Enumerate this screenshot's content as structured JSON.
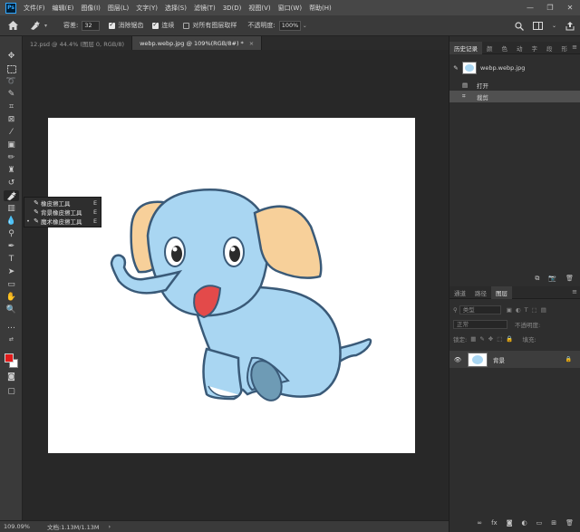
{
  "app": {
    "logo": "Ps",
    "menu": [
      "文件(F)",
      "编辑(E)",
      "图像(I)",
      "图层(L)",
      "文字(Y)",
      "选择(S)",
      "滤镜(T)",
      "3D(D)",
      "视图(V)",
      "窗口(W)",
      "帮助(H)"
    ],
    "window_controls": {
      "minimize": "—",
      "restore": "❐",
      "close": "✕"
    }
  },
  "options": {
    "tolerance_label": "容差:",
    "tolerance_value": "32",
    "antialias_label": "消除锯齿",
    "contiguous_label": "连续",
    "all_layers_label": "对所有图层取样",
    "opacity_label": "不透明度:",
    "opacity_value": "100%"
  },
  "tabs": [
    {
      "label": "12.psd @ 44.4% (图层 0, RGB/8)",
      "active": false
    },
    {
      "label": "webp.webp.jpg @ 109%(RGB/8#) *",
      "active": true,
      "close": "×"
    }
  ],
  "flyout": {
    "items": [
      {
        "label": "橡皮擦工具",
        "key": "E",
        "selected": false
      },
      {
        "label": "背景橡皮擦工具",
        "key": "E",
        "selected": false
      },
      {
        "label": "魔术橡皮擦工具",
        "key": "E",
        "selected": true
      }
    ],
    "dot": "•"
  },
  "status": {
    "zoom": "109.09%",
    "doc": "文档:1.13M/1.13M",
    "arrow": "›"
  },
  "history_panel": {
    "tabs": [
      "历史记录",
      "颜",
      "色",
      "动",
      "字",
      "段",
      "形"
    ],
    "snapshot_name": "webp.webp.jpg",
    "items": [
      {
        "label": "打开",
        "selected": false
      },
      {
        "label": "裁剪",
        "selected": true
      }
    ]
  },
  "layers_panel": {
    "tabs": [
      "通道",
      "路径",
      "图层"
    ],
    "filter_label": "类型",
    "blend_mode": "正常",
    "opacity_label": "不透明度:",
    "lock_label": "锁定:",
    "fill_label": "填充:",
    "layer_name": "背景",
    "lock_icon": "🔒"
  },
  "colors": {
    "foreground": "#e21b1b",
    "background": "#ffffff",
    "elephant_body": "#a9d6f2",
    "elephant_ear": "#f7d09a"
  }
}
